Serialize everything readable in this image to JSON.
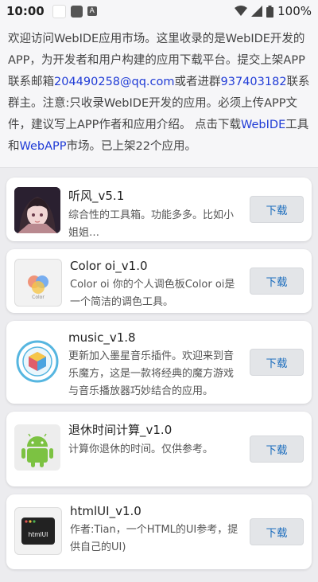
{
  "status_bar": {
    "time": "10:00",
    "battery": "100%",
    "a_badge": "A"
  },
  "intro": {
    "text1": "欢迎访问WebIDE应用市场。这里收录的是WebIDE开发的APP，为开发者和用户构建的应用下载平台。提交上架APP联系邮箱",
    "email": "204490258@qq.com",
    "text2": "或者进群",
    "group": "937403182",
    "text3": "联系群主。注意:只收录WebIDE开发的应用。必须上传APP文件，建议写上APP作者和应用介绍。 点击下载",
    "link1": "WebIDE",
    "text4": "工具和",
    "link2": "WebAPP",
    "text5": "市场。已上架22个应用。"
  },
  "apps": [
    {
      "title": "听风_v5.1",
      "desc": "综合性的工具箱。功能多多。比如小姐姐…",
      "button": "下载",
      "icon": "anime-girl-icon"
    },
    {
      "title": "Color oi_v1.0",
      "desc": "Color oi 你的个人调色板Color oi是一个简洁的调色工具。",
      "button": "下载",
      "icon": "color-palette-icon",
      "icon_label": "Color"
    },
    {
      "title": "music_v1.8",
      "desc": "更新加入墨星音乐插件。欢迎来到音乐魔方，这是一款将经典的魔方游戏与音乐播放器巧妙结合的应用。",
      "button": "下载",
      "icon": "music-cube-icon"
    },
    {
      "title": "退休时间计算_v1.0",
      "desc": "计算你退休的时间。仅供参考。",
      "button": "下载",
      "icon": "android-icon"
    },
    {
      "title": "htmlUI_v1.0",
      "desc": "作者:Tian，一个HTML的UI参考，提供自己的UI)",
      "button": "下载",
      "icon": "htmlui-icon",
      "icon_label": "htmlUI"
    }
  ],
  "colors": {
    "link": "#1f3bd6",
    "button_text": "#1f6fbe",
    "background": "#ececef"
  }
}
